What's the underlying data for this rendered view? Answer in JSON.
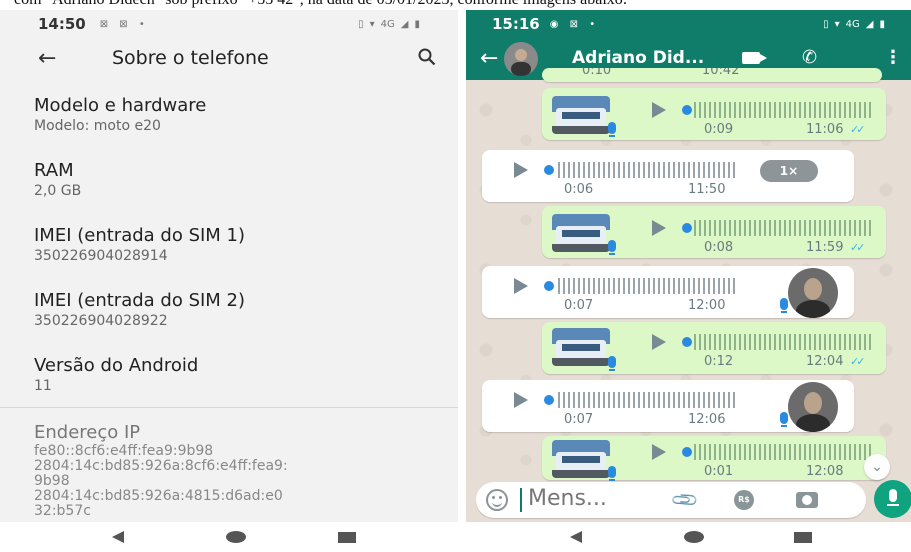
{
  "caption": "com \"Adriano Didech\" sob prefixo \"+55 42\", na data de 05/01/2023, conforme imagens abaixo:",
  "left_phone": {
    "status_time": "14:50",
    "status_net": "4G",
    "title": "Sobre o telefone",
    "items": [
      {
        "label": "Modelo e hardware",
        "value": "Modelo: moto e20"
      },
      {
        "label": "RAM",
        "value": "2,0 GB"
      },
      {
        "label": "IMEI (entrada do SIM 1)",
        "value": "350226904028914"
      },
      {
        "label": "IMEI (entrada do SIM 2)",
        "value": "350226904028922"
      },
      {
        "label": "Versão do Android",
        "value": "11"
      }
    ],
    "ip": {
      "label": "Endereço IP",
      "value": "fe80::8cf6:e4ff:fea9:9b98\n2804:14c:bd85:926a:8cf6:e4ff:fea9:\n9b98\n2804:14c:bd85:926a:4815:d6ad:e0\n32:b57c"
    }
  },
  "right_phone": {
    "status_time": "15:16",
    "status_net": "4G",
    "contact_name": "Adriano Did...",
    "top_partial": {
      "dur": "0:10",
      "time": "10:42"
    },
    "messages": [
      {
        "dir": "out",
        "dur": "0:09",
        "time": "11:06"
      },
      {
        "dir": "in",
        "dur": "0:06",
        "time": "11:50",
        "speed": "1×"
      },
      {
        "dir": "out",
        "dur": "0:08",
        "time": "11:59"
      },
      {
        "dir": "in",
        "dur": "0:07",
        "time": "12:00"
      },
      {
        "dir": "out",
        "dur": "0:12",
        "time": "12:04"
      },
      {
        "dir": "in",
        "dur": "0:07",
        "time": "12:06"
      },
      {
        "dir": "out",
        "dur": "0:01",
        "time": "12:08"
      }
    ],
    "input_placeholder": "Mens...",
    "money_label": "R$"
  }
}
